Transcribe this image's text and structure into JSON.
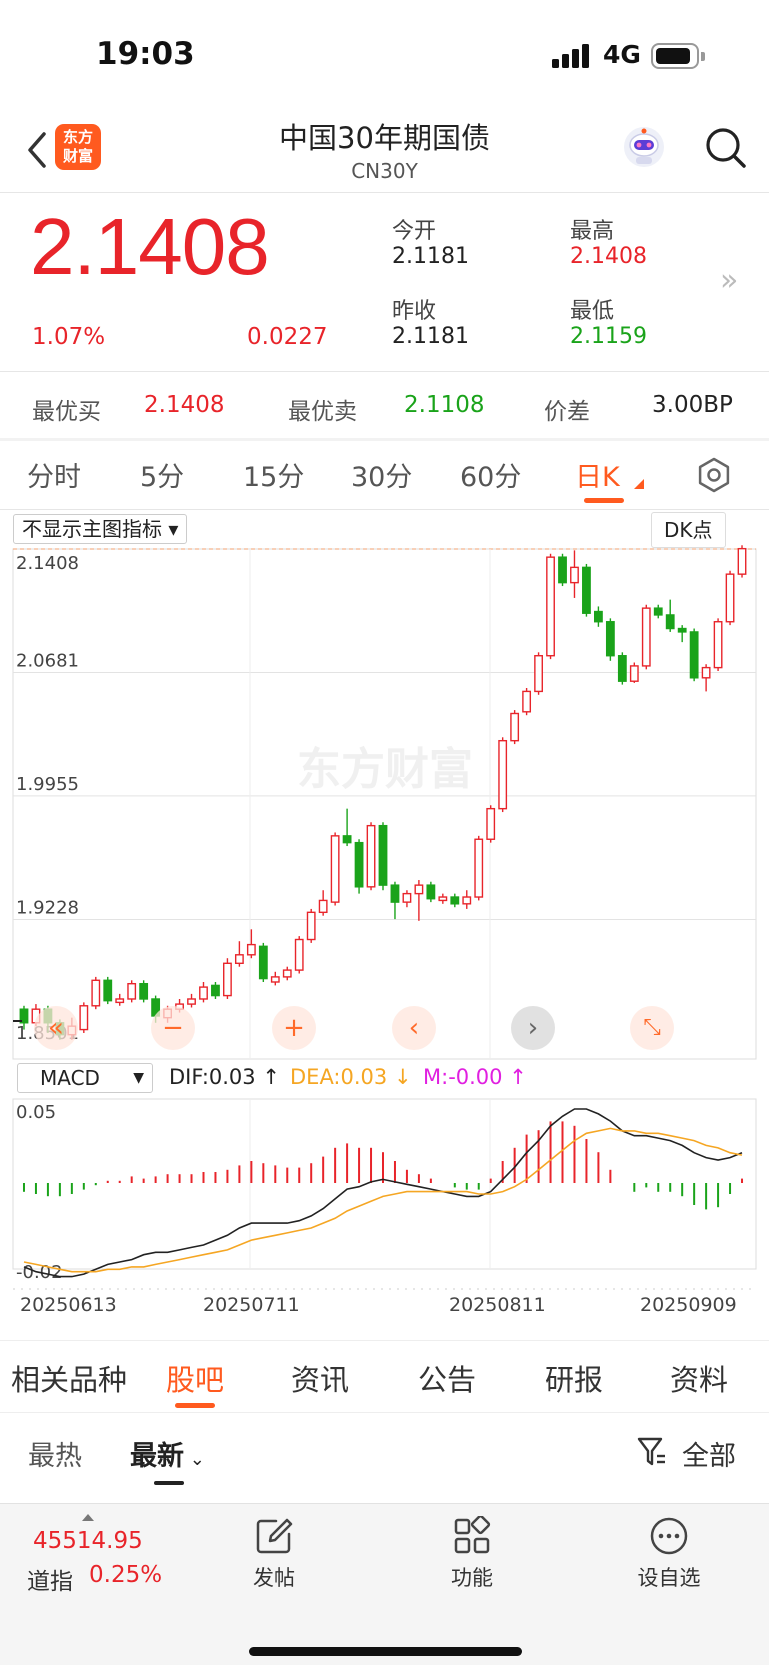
{
  "status": {
    "time": "19:03",
    "network": "4G"
  },
  "nav": {
    "title": "中国30年期国债",
    "code": "CN30Y",
    "logo_line1": "东方",
    "logo_line2": "财富"
  },
  "quote": {
    "price": "2.1408",
    "change_pct": "1.07%",
    "change": "0.0227",
    "open_label": "今开",
    "open": "2.1181",
    "high_label": "最高",
    "high": "2.1408",
    "prev_close_label": "昨收",
    "prev_close": "2.1181",
    "low_label": "最低",
    "low": "2.1159"
  },
  "bbo": {
    "bid_label": "最优买",
    "bid": "2.1408",
    "ask_label": "最优卖",
    "ask": "2.1108",
    "spread_label": "价差",
    "spread": "3.00BP"
  },
  "period_tabs": [
    "分时",
    "5分",
    "15分",
    "30分",
    "60分",
    "日K"
  ],
  "period_active": "日K",
  "chart_ui": {
    "indicator_select": "不显示主图指标",
    "dk_select": "DK点",
    "watermark": "东方财富",
    "macd_select": "MACD",
    "dif_label": "DIF:0.03",
    "dea_label": "DEA:0.03",
    "m_label": "M:-0.00",
    "macd_top_tick": "0.05",
    "macd_bottom_tick": "-0.02"
  },
  "chart_data": [
    {
      "type": "candlestick",
      "y_ticks": [
        "2.1408",
        "2.0681",
        "1.9955",
        "1.9228",
        "1.8501"
      ],
      "ylim": [
        1.8501,
        2.1408
      ],
      "x_ticks": [
        "20250613",
        "20250711",
        "20250811",
        "20250909"
      ],
      "grid": true,
      "candles": [
        [
          1.87,
          1.862,
          1.872,
          1.858
        ],
        [
          1.862,
          1.87,
          1.873,
          1.86
        ],
        [
          1.87,
          1.862,
          1.872,
          1.856
        ],
        [
          1.862,
          1.855,
          1.864,
          1.852
        ],
        [
          1.855,
          1.86,
          1.865,
          1.852
        ],
        [
          1.858,
          1.872,
          1.874,
          1.856
        ],
        [
          1.872,
          1.887,
          1.889,
          1.87
        ],
        [
          1.887,
          1.875,
          1.889,
          1.873
        ],
        [
          1.874,
          1.876,
          1.879,
          1.872
        ],
        [
          1.876,
          1.885,
          1.887,
          1.874
        ],
        [
          1.885,
          1.876,
          1.887,
          1.874
        ],
        [
          1.876,
          1.866,
          1.878,
          1.862
        ],
        [
          1.865,
          1.87,
          1.872,
          1.862
        ],
        [
          1.87,
          1.873,
          1.876,
          1.868
        ],
        [
          1.873,
          1.876,
          1.879,
          1.871
        ],
        [
          1.876,
          1.883,
          1.886,
          1.874
        ],
        [
          1.884,
          1.878,
          1.886,
          1.876
        ],
        [
          1.878,
          1.897,
          1.9,
          1.876
        ],
        [
          1.897,
          1.902,
          1.91,
          1.895
        ],
        [
          1.902,
          1.908,
          1.917,
          1.9
        ],
        [
          1.907,
          1.888,
          1.909,
          1.886
        ],
        [
          1.886,
          1.889,
          1.892,
          1.884
        ],
        [
          1.889,
          1.893,
          1.895,
          1.887
        ],
        [
          1.893,
          1.911,
          1.913,
          1.891
        ],
        [
          1.911,
          1.927,
          1.929,
          1.909
        ],
        [
          1.927,
          1.934,
          1.94,
          1.925
        ],
        [
          1.933,
          1.972,
          1.974,
          1.931
        ],
        [
          1.972,
          1.968,
          1.988,
          1.966
        ],
        [
          1.968,
          1.942,
          1.97,
          1.938
        ],
        [
          1.942,
          1.978,
          1.98,
          1.94
        ],
        [
          1.978,
          1.943,
          1.98,
          1.94
        ],
        [
          1.943,
          1.933,
          1.945,
          1.923
        ],
        [
          1.933,
          1.938,
          1.94,
          1.93
        ],
        [
          1.938,
          1.943,
          1.946,
          1.922
        ],
        [
          1.943,
          1.935,
          1.945,
          1.933
        ],
        [
          1.934,
          1.936,
          1.938,
          1.932
        ],
        [
          1.936,
          1.932,
          1.938,
          1.93
        ],
        [
          1.932,
          1.936,
          1.94,
          1.929
        ],
        [
          1.936,
          1.97,
          1.972,
          1.934
        ],
        [
          1.97,
          1.988,
          1.99,
          1.968
        ],
        [
          1.988,
          2.028,
          2.03,
          1.986
        ],
        [
          2.028,
          2.044,
          2.046,
          2.026
        ],
        [
          2.045,
          2.057,
          2.059,
          2.043
        ],
        [
          2.057,
          2.078,
          2.08,
          2.055
        ],
        [
          2.078,
          2.136,
          2.138,
          2.076
        ],
        [
          2.136,
          2.121,
          2.138,
          2.119
        ],
        [
          2.121,
          2.13,
          2.14,
          2.112
        ],
        [
          2.13,
          2.103,
          2.132,
          2.101
        ],
        [
          2.104,
          2.098,
          2.107,
          2.095
        ],
        [
          2.098,
          2.078,
          2.1,
          2.075
        ],
        [
          2.078,
          2.063,
          2.08,
          2.061
        ],
        [
          2.063,
          2.072,
          2.074,
          2.062
        ],
        [
          2.072,
          2.106,
          2.108,
          2.07
        ],
        [
          2.106,
          2.102,
          2.108,
          2.1
        ],
        [
          2.102,
          2.094,
          2.111,
          2.092
        ],
        [
          2.094,
          2.092,
          2.096,
          2.086
        ],
        [
          2.092,
          2.065,
          2.094,
          2.063
        ],
        [
          2.065,
          2.071,
          2.073,
          2.057
        ],
        [
          2.071,
          2.098,
          2.1,
          2.069
        ],
        [
          2.098,
          2.126,
          2.128,
          2.096
        ],
        [
          2.126,
          2.141,
          2.143,
          2.124
        ]
      ]
    },
    {
      "type": "line",
      "name": "MACD",
      "ylim": [
        -0.02,
        0.05
      ],
      "series": [
        {
          "name": "DIF",
          "color": "#222222",
          "values": [
            -0.015,
            -0.017,
            -0.018,
            -0.019,
            -0.019,
            -0.018,
            -0.016,
            -0.014,
            -0.013,
            -0.012,
            -0.01,
            -0.009,
            -0.009,
            -0.008,
            -0.007,
            -0.006,
            -0.004,
            -0.002,
            0.001,
            0.003,
            0.003,
            0.003,
            0.003,
            0.004,
            0.006,
            0.009,
            0.013,
            0.017,
            0.018,
            0.02,
            0.021,
            0.02,
            0.019,
            0.018,
            0.017,
            0.016,
            0.015,
            0.014,
            0.014,
            0.016,
            0.021,
            0.026,
            0.032,
            0.037,
            0.043,
            0.047,
            0.05,
            0.05,
            0.048,
            0.045,
            0.041,
            0.039,
            0.039,
            0.038,
            0.037,
            0.035,
            0.032,
            0.03,
            0.029,
            0.03,
            0.032
          ]
        },
        {
          "name": "DEA",
          "color": "#f5a623",
          "values": [
            -0.013,
            -0.014,
            -0.015,
            -0.016,
            -0.017,
            -0.017,
            -0.017,
            -0.016,
            -0.016,
            -0.015,
            -0.015,
            -0.014,
            -0.013,
            -0.012,
            -0.011,
            -0.01,
            -0.009,
            -0.008,
            -0.006,
            -0.004,
            -0.003,
            -0.002,
            -0.001,
            0.0,
            0.001,
            0.003,
            0.005,
            0.008,
            0.01,
            0.012,
            0.014,
            0.015,
            0.016,
            0.016,
            0.016,
            0.016,
            0.016,
            0.016,
            0.015,
            0.015,
            0.016,
            0.018,
            0.021,
            0.025,
            0.029,
            0.033,
            0.037,
            0.04,
            0.041,
            0.042,
            0.041,
            0.041,
            0.04,
            0.04,
            0.039,
            0.038,
            0.037,
            0.035,
            0.034,
            0.032,
            0.031
          ]
        },
        {
          "name": "M",
          "type": "bar",
          "values": [
            -0.004,
            -0.005,
            -0.006,
            -0.006,
            -0.005,
            -0.003,
            -0.001,
            0.001,
            0.001,
            0.003,
            0.002,
            0.003,
            0.004,
            0.004,
            0.004,
            0.005,
            0.005,
            0.006,
            0.008,
            0.01,
            0.009,
            0.008,
            0.007,
            0.007,
            0.009,
            0.012,
            0.016,
            0.018,
            0.016,
            0.016,
            0.014,
            0.01,
            0.006,
            0.004,
            0.002,
            0.0,
            -0.002,
            -0.003,
            -0.003,
            0.002,
            0.01,
            0.016,
            0.022,
            0.024,
            0.028,
            0.028,
            0.026,
            0.02,
            0.014,
            0.006,
            0.0,
            -0.004,
            -0.002,
            -0.004,
            -0.004,
            -0.006,
            -0.01,
            -0.012,
            -0.011,
            -0.005,
            0.002
          ]
        }
      ]
    }
  ],
  "section_tabs": [
    "相关品种",
    "股吧",
    "资讯",
    "公告",
    "研报",
    "资料"
  ],
  "section_active": "股吧",
  "sort": {
    "hot": "最热",
    "latest": "最新",
    "all": "全部"
  },
  "bottom": {
    "index_value": "45514.95",
    "index_name": "道指",
    "index_pct": "0.25%",
    "post": "发帖",
    "functions": "功能",
    "watchlist": "设自选"
  },
  "colors": {
    "up": "#e8242a",
    "down": "#1aa31a",
    "accent": "#ff5a1f",
    "dif": "#222222",
    "dea": "#f5a623",
    "m": "#e020e0"
  }
}
